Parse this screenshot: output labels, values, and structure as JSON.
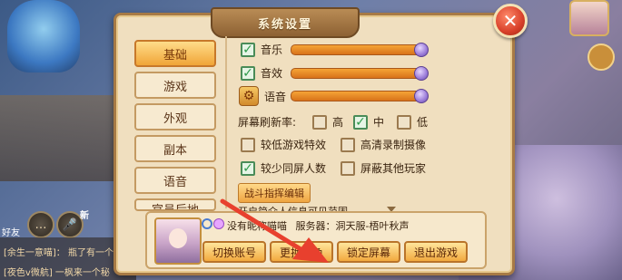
{
  "background": {
    "chat_lines": [
      "[余生一意喵]：  瓶了有一个",
      "[夜色v微航]  一枫来一个秘"
    ],
    "friend_label": "好友",
    "new_tag": "新"
  },
  "dialog": {
    "title": "系统设置",
    "tabs": [
      "基础",
      "游戏",
      "外观",
      "副本",
      "语音",
      "官员后地"
    ],
    "active_tab": "基础",
    "settings": {
      "music": {
        "label": "音乐",
        "checked": true,
        "level": 1.0
      },
      "sfx": {
        "label": "音效",
        "checked": true,
        "level": 1.0
      },
      "voice": {
        "label": "语音",
        "level": 1.0
      },
      "refresh_label": "屏幕刷新率:",
      "refresh_options": [
        {
          "label": "高",
          "checked": false
        },
        {
          "label": "中",
          "checked": true
        },
        {
          "label": "低",
          "checked": false
        }
      ],
      "options": [
        {
          "label": "较低游戏特效",
          "checked": false
        },
        {
          "label": "高清录制摄像",
          "checked": false
        },
        {
          "label": "较少同屏人数",
          "checked": true
        },
        {
          "label": "屏蔽其他玩家",
          "checked": false
        }
      ],
      "command_button": "战斗指挥编辑",
      "cut_text": "开启简介人信息可见范围"
    },
    "player": {
      "nickname": "没有昵称喵喵",
      "server_label": "服务器：洞天服-梧叶秋声"
    },
    "buttons": [
      "切换账号",
      "更换角色",
      "锁定屏幕",
      "退出游戏"
    ]
  },
  "colors": {
    "accent": "#f0a537",
    "annotation_arrow": "#e8402e"
  }
}
